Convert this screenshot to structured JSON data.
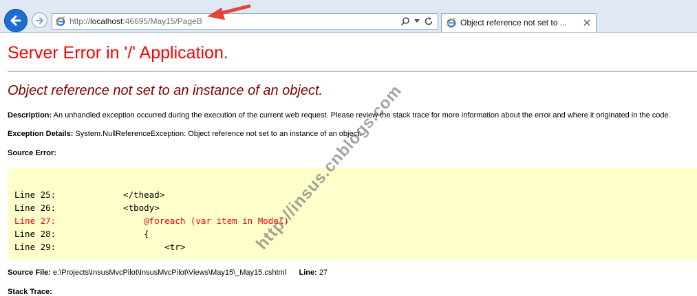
{
  "browser": {
    "url_prefix": "http://",
    "url_host": "localhost",
    "url_rest": ":46695/May15/PageB",
    "tab_title": "Object reference not set to ...",
    "icons": [
      "back-icon",
      "forward-icon",
      "ie-logo-icon",
      "search-icon",
      "dropdown-icon",
      "refresh-icon",
      "close-icon"
    ]
  },
  "page": {
    "title": "Server Error in '/' Application.",
    "error_message": "Object reference not set to an instance of an object.",
    "description_label": "Description:",
    "description_text": "An unhandled exception occurred during the execution of the current web request. Please review the stack trace for more information about the error and where it originated in the code.",
    "exception_label": "Exception Details:",
    "exception_text": "System.NullReferenceException: Object reference not set to an instance of an object.",
    "source_error_label": "Source Error:",
    "source_lines": [
      {
        "label": "Line 25:",
        "code": "        </thead>"
      },
      {
        "label": "Line 26:",
        "code": "        <tbody>"
      },
      {
        "label": "Line 27:",
        "code": "            @foreach (var item in Model)"
      },
      {
        "label": "Line 28:",
        "code": "            {"
      },
      {
        "label": "Line 29:",
        "code": "                <tr>"
      }
    ],
    "error_line_index": 2,
    "source_file_label": "Source File:",
    "source_file_path": "e:\\Projects\\InsusMvcPilot\\InsusMvcPilot\\Views\\May15\\_May15.cshtml",
    "line_label": "Line:",
    "line_number": "27",
    "stack_trace_label": "Stack Trace:"
  },
  "watermark": "http://insus.cnblogs.com",
  "colors": {
    "title": "#ff0000",
    "error_message": "#800000",
    "source_background": "#ffffcc",
    "error_line": "#ff0000",
    "annotation_arrow": "#e8403a"
  }
}
